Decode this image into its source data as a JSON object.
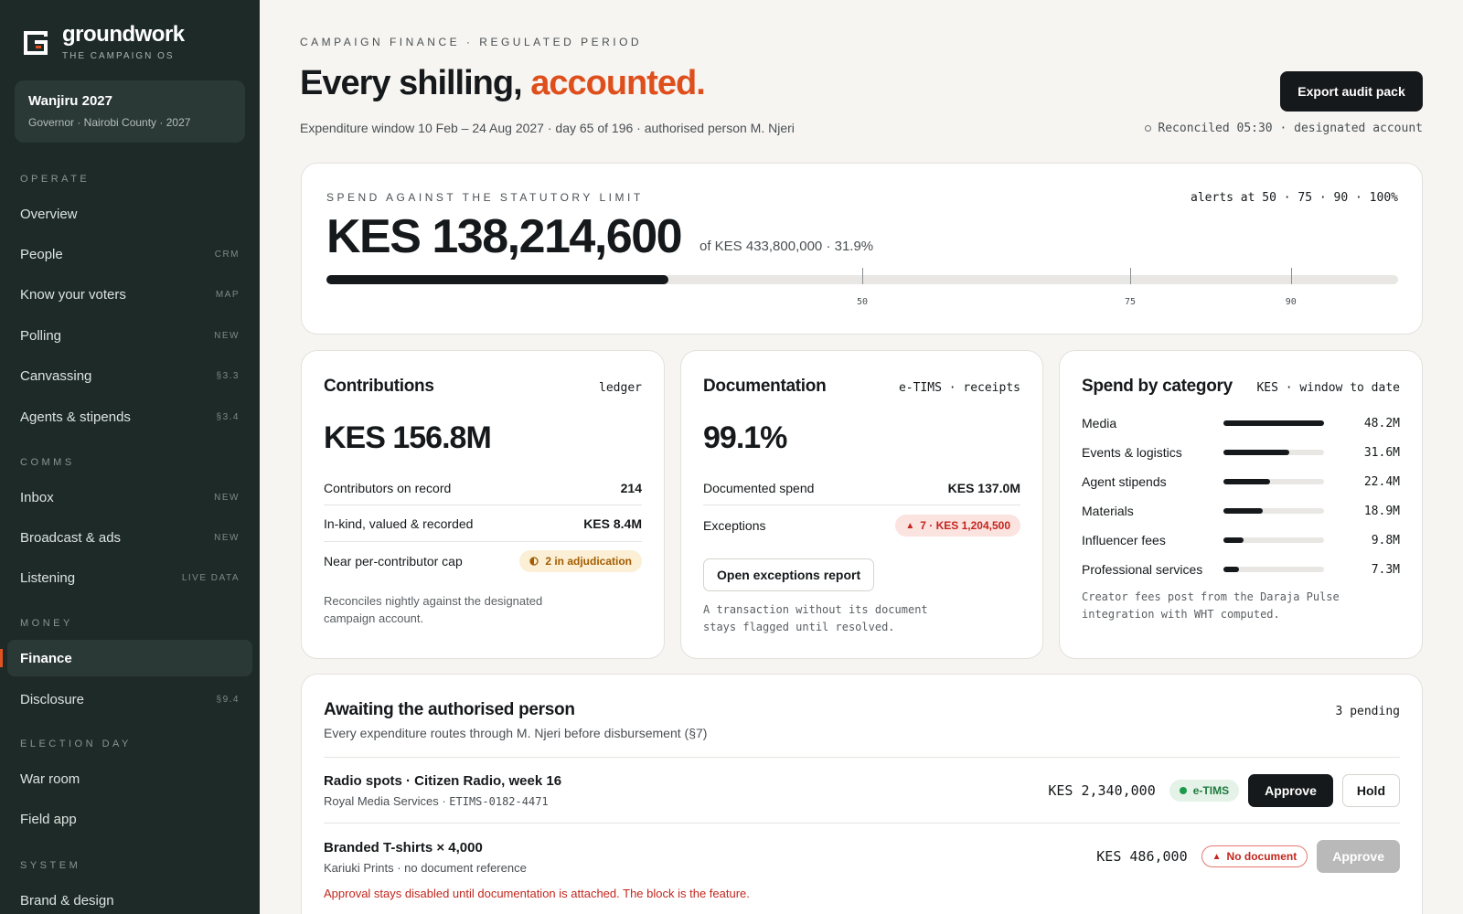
{
  "brand": {
    "name": "groundwork",
    "tagline": "THE CAMPAIGN OS",
    "logo_icon": "g-logo-icon"
  },
  "campaign": {
    "name": "Wanjiru 2027",
    "details": "Governor · Nairobi County · 2027"
  },
  "nav": {
    "sections": [
      {
        "title": "OPERATE"
      },
      {
        "title": "COMMS"
      },
      {
        "title": "MONEY"
      },
      {
        "title": "ELECTION DAY"
      },
      {
        "title": "SYSTEM"
      }
    ],
    "items": [
      {
        "label": "Overview",
        "badge": ""
      },
      {
        "label": "People",
        "badge": "CRM"
      },
      {
        "label": "Know your voters",
        "badge": "MAP"
      },
      {
        "label": "Polling",
        "badge": "NEW"
      },
      {
        "label": "Canvassing",
        "badge": "§3.3"
      },
      {
        "label": "Agents & stipends",
        "badge": "§3.4"
      },
      {
        "label": "Inbox",
        "badge": "NEW"
      },
      {
        "label": "Broadcast & ads",
        "badge": "NEW"
      },
      {
        "label": "Listening",
        "badge": "LIVE DATA"
      },
      {
        "label": "Finance",
        "badge": "",
        "active": true
      },
      {
        "label": "Disclosure",
        "badge": "§9.4"
      },
      {
        "label": "War room",
        "badge": ""
      },
      {
        "label": "Field app",
        "badge": ""
      },
      {
        "label": "Brand & design",
        "badge": ""
      }
    ]
  },
  "header": {
    "eyebrow": "CAMPAIGN FINANCE · REGULATED PERIOD",
    "title_main": "Every shilling, ",
    "title_accent": "accounted.",
    "subtitle": "Expenditure window 10 Feb – 24 Aug 2027 · day 65 of 196 · authorised person M. Njeri",
    "export_label": "Export audit pack",
    "reconciled": "Reconciled 05:30 · designated account",
    "accent_color": "#de4f1c"
  },
  "limit": {
    "eyebrow": "SPEND AGAINST THE STATUTORY LIMIT",
    "alerts": "alerts at 50 · 75 · 90 · 100%",
    "value": "KES 138,214,600",
    "of": "of KES 433,800,000 · 31.9%",
    "percent": 31.9,
    "marks": [
      {
        "value": 50,
        "label": "50"
      },
      {
        "value": 75,
        "label": "75"
      },
      {
        "value": 90,
        "label": "90"
      }
    ]
  },
  "contributions": {
    "title": "Contributions",
    "tag": "ledger",
    "big": "KES 156.8M",
    "rows": [
      {
        "label": "Contributors on record",
        "value": "214"
      },
      {
        "label": "In-kind, valued & recorded",
        "value": "KES 8.4M"
      },
      {
        "label": "Near per-contributor cap",
        "value": "2 in adjudication",
        "icon": "half-circle-icon"
      }
    ],
    "note": "Reconciles nightly against the designated campaign account."
  },
  "documentation": {
    "title": "Documentation",
    "tag": "e-TIMS · receipts",
    "big": "99.1%",
    "rows": [
      {
        "label": "Documented spend",
        "value": "KES 137.0M"
      },
      {
        "label": "Exceptions",
        "value": "7 · KES 1,204,500",
        "icon": "warning-triangle-icon"
      }
    ],
    "button": "Open exceptions report",
    "note": "A transaction without its document stays flagged until resolved."
  },
  "categories": {
    "title": "Spend by category",
    "tag": "KES · window to date",
    "items": [
      {
        "name": "Media",
        "value": 48.2,
        "label": "48.2M"
      },
      {
        "name": "Events & logistics",
        "value": 31.6,
        "label": "31.6M"
      },
      {
        "name": "Agent stipends",
        "value": 22.4,
        "label": "22.4M"
      },
      {
        "name": "Materials",
        "value": 18.9,
        "label": "18.9M"
      },
      {
        "name": "Influencer fees",
        "value": 9.8,
        "label": "9.8M"
      },
      {
        "name": "Professional services",
        "value": 7.3,
        "label": "7.3M"
      }
    ],
    "note": "Creator fees post from the Daraja Pulse integration with WHT computed."
  },
  "approvals": {
    "title": "Awaiting the authorised person",
    "subtitle": "Every expenditure routes through M. Njeri before disbursement (§7)",
    "count": "3 pending",
    "items": [
      {
        "name": "Radio spots · Citizen Radio, week 16",
        "vendor": "Royal Media Services · ",
        "ref": "ETIMS-0182-4471",
        "amount": "KES 2,340,000",
        "status": "e-TIMS",
        "approve": "Approve",
        "hold": "Hold"
      },
      {
        "name": "Branded T-shirts × 4,000",
        "vendor": "Kariuki Prints · no document reference",
        "amount": "KES 486,000",
        "status": "No document",
        "approve": "Approve",
        "warning": "Approval stays disabled until documentation is attached. The block is the feature."
      }
    ]
  }
}
